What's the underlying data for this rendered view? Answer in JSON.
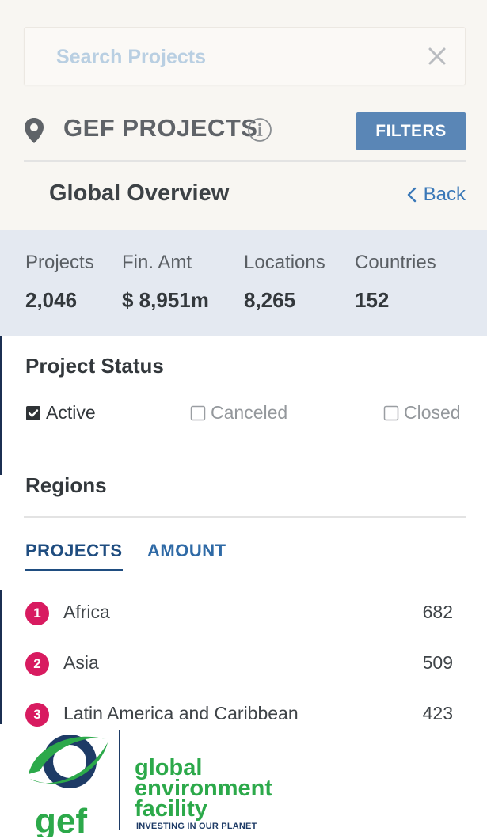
{
  "search": {
    "placeholder": "Search Projects"
  },
  "header": {
    "title": "GEF PROJECTS",
    "filters_label": "FILTERS"
  },
  "overview": {
    "title": "Global Overview",
    "back_label": "Back"
  },
  "stats": [
    {
      "label": "Projects",
      "value": "2,046"
    },
    {
      "label": "Fin. Amt",
      "value": "$ 8,951m"
    },
    {
      "label": "Locations",
      "value": "8,265"
    },
    {
      "label": "Countries",
      "value": "152"
    }
  ],
  "status": {
    "title": "Project Status",
    "options": [
      {
        "label": "Active",
        "checked": true
      },
      {
        "label": "Canceled",
        "checked": false
      },
      {
        "label": "Closed",
        "checked": false
      }
    ]
  },
  "regions": {
    "title": "Regions",
    "tabs": [
      {
        "label": "PROJECTS",
        "active": true
      },
      {
        "label": "AMOUNT",
        "active": false
      }
    ],
    "items": [
      {
        "rank": "1",
        "name": "Africa",
        "value": "682"
      },
      {
        "rank": "2",
        "name": "Asia",
        "value": "509"
      },
      {
        "rank": "3",
        "name": "Latin America and Caribbean",
        "value": "423"
      }
    ]
  },
  "logo": {
    "wordmark": "gef",
    "line1": "global",
    "line2": "environment",
    "line3": "facility",
    "tagline": "INVESTING IN OUR PLANET"
  },
  "colors": {
    "accent": "#5a86b6",
    "link": "#3a78b8",
    "badge": "#d81b60",
    "logo_green": "#2ca94a",
    "logo_navy": "#1e3b66"
  }
}
